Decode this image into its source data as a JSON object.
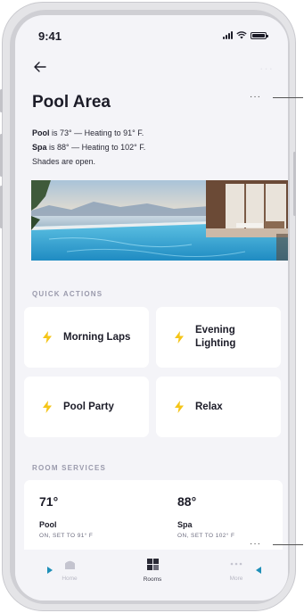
{
  "status_bar": {
    "time": "9:41"
  },
  "header": {
    "more_glyph": "···"
  },
  "page": {
    "title": "Pool Area",
    "title_menu_glyph": "···",
    "status_lines": [
      {
        "name": "Pool",
        "rest": " is 73° — Heating to 91° F."
      },
      {
        "name": "Spa",
        "rest": " is 88° — Heating to 102° F."
      },
      {
        "text": "Shades are open."
      }
    ]
  },
  "quick_actions": {
    "label": "QUICK ACTIONS",
    "items": [
      {
        "label": "Morning Laps"
      },
      {
        "label": "Evening Lighting"
      },
      {
        "label": "Pool Party"
      },
      {
        "label": "Relax"
      }
    ]
  },
  "room_services": {
    "label": "ROOM SERVICES",
    "items": [
      {
        "temp": "71°",
        "name": "Pool",
        "status": "ON, SET TO 91° F"
      },
      {
        "temp": "88°",
        "name": "Spa",
        "status": "ON, SET TO 102° F"
      }
    ],
    "menu_glyph": "···"
  },
  "tabbar": {
    "tabs": [
      {
        "label": "Home",
        "icon": "home-icon"
      },
      {
        "label": "Rooms",
        "icon": "rooms-icon"
      },
      {
        "label": "More",
        "icon": "more-icon"
      }
    ]
  },
  "colors": {
    "accent_bolt": "#f5c518",
    "arrow": "#1e8fb8",
    "screen_bg": "#f4f4f8",
    "card_bg": "#ffffff"
  }
}
